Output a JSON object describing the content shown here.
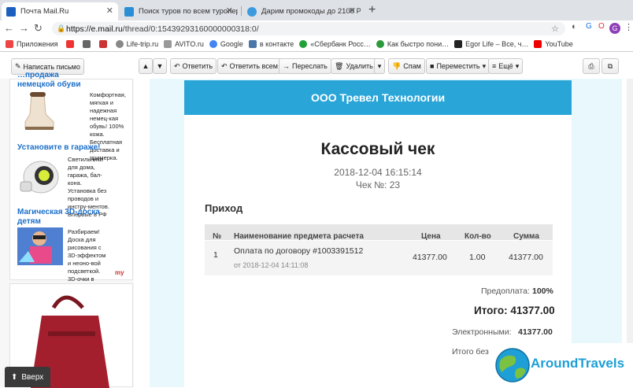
{
  "browser": {
    "tabs": [
      {
        "title": "Почта Mail.Ru",
        "icon": "mailru-icon",
        "color": "#1c5fbf"
      },
      {
        "title": "Поиск туров по всем туропер",
        "icon": "search-tours-icon",
        "color": "#2b8fd6"
      },
      {
        "title": "Дарим промокоды до 2100 Р",
        "icon": "globe-icon",
        "color": "#3a9be0"
      }
    ],
    "new_tab": "+",
    "url_host": "https://e.mail.ru",
    "url_path": "/thread/0:15439293160000000318:0/",
    "bookmarks": [
      {
        "label": "Приложения",
        "color": "#e44"
      },
      {
        "label": "",
        "color": "#e33"
      },
      {
        "label": "",
        "color": "#666"
      },
      {
        "label": "",
        "color": "#c33"
      },
      {
        "label": "Life-trip.ru",
        "color": "#888"
      },
      {
        "label": "AVITO.ru",
        "color": "#999"
      },
      {
        "label": "Google",
        "color": "#4285f4"
      },
      {
        "label": "в контакте",
        "color": "#4a76a8"
      },
      {
        "label": "«Сбербанк Росс…",
        "color": "#21a038"
      },
      {
        "label": "Как быстро пони…",
        "color": "#2b9a3a"
      },
      {
        "label": "Egor Life – Все, ч…",
        "color": "#222"
      },
      {
        "label": "YouTube",
        "color": "#e00"
      }
    ]
  },
  "toolbar": {
    "compose": "Написать письмо",
    "reply": "Ответить",
    "reply_all": "Ответить всем",
    "forward": "Переслать",
    "delete": "Удалить",
    "spam": "Спам",
    "move": "Переместить",
    "more": "Ещё"
  },
  "ads": [
    {
      "title": "…продажа немецкой обуви",
      "text": "Комфортная, мягкая и надежная немец-кая обувь! 100% кожа. Бесплатная доставка и примерка."
    },
    {
      "title": "Установите в гараже!",
      "text": "Светильники для дома, гаража, бал-кона. Установка без проводов и инстру-ментов. Впервые в РФ"
    },
    {
      "title": "Магическая 3D-доска детям",
      "text": "Разбираем! Доска для рисования с 3D-эффектом и неоно-вой подсветкой. 3D-очки в подарок."
    }
  ],
  "ad_brand": "my",
  "scroll_top": "Вверх",
  "receipt": {
    "company": "ООО Тревел Технологии",
    "title": "Кассовый чек",
    "datetime": "2018-12-04 16:15:14",
    "number": "Чек №: 23",
    "section": "Приход",
    "columns": [
      "№",
      "Наименование предмета расчета",
      "Цена",
      "Кол-во",
      "Сумма"
    ],
    "rows": [
      {
        "n": "1",
        "name": "Оплата по договору #1003391512",
        "sub": "от 2018-12-04 14:11:08",
        "price": "41377.00",
        "qty": "1.00",
        "sum": "41377.00"
      }
    ],
    "prepay_label": "Предоплата:",
    "prepay_value": "100%",
    "total": "Итого: 41377.00",
    "electronic_label": "Электронными:",
    "electronic_value": "41377.00",
    "cut_line": "Итого без"
  },
  "watermark": "AroundTravels"
}
